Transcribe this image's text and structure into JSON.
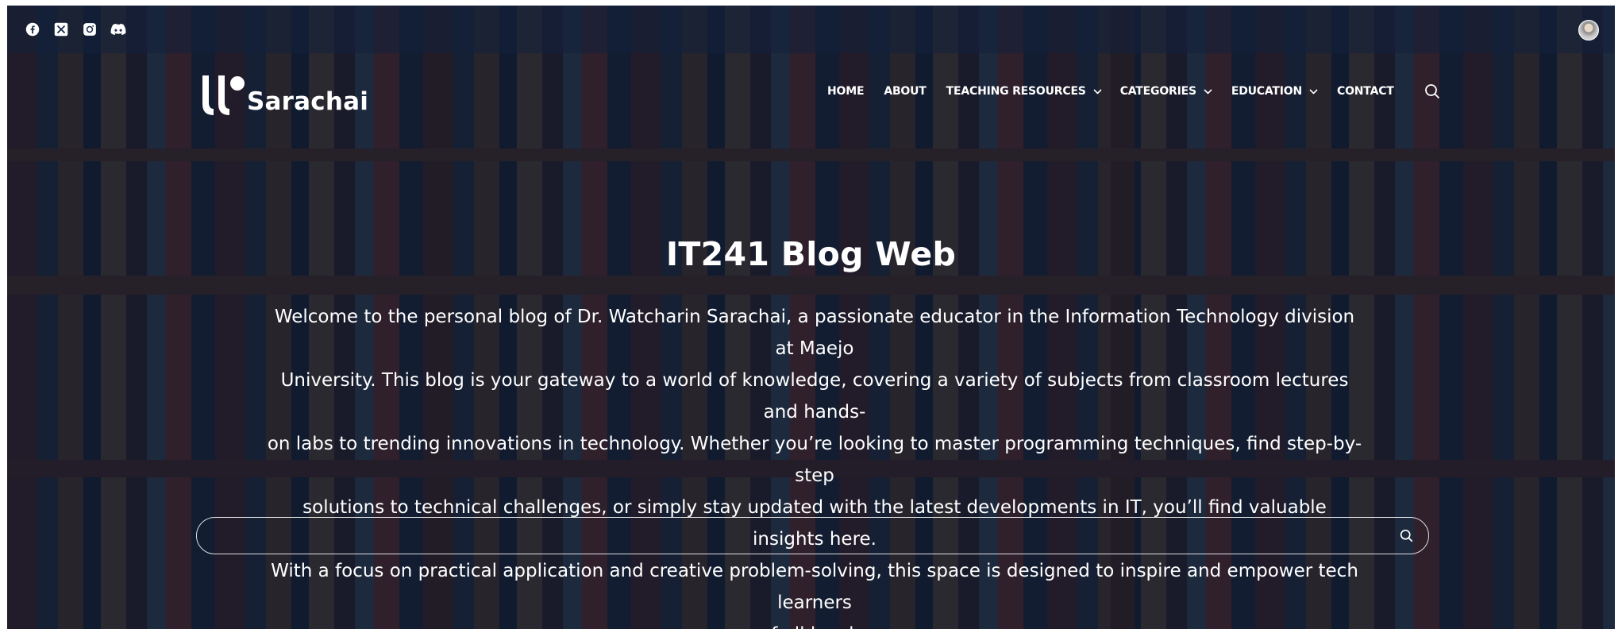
{
  "colors": {
    "overlay": "#0c162c",
    "text": "#ffffff",
    "topbar": "#12203c"
  },
  "topbar": {
    "social": [
      {
        "icon": "facebook-icon"
      },
      {
        "icon": "x-twitter-icon"
      },
      {
        "icon": "instagram-icon"
      },
      {
        "icon": "discord-icon"
      }
    ],
    "avatar_icon": "user-avatar"
  },
  "header": {
    "logo_text": "Sarachai",
    "nav": [
      {
        "label": "HOME",
        "dropdown": false
      },
      {
        "label": "ABOUT",
        "dropdown": false
      },
      {
        "label": "TEACHING RESOURCES",
        "dropdown": true
      },
      {
        "label": "CATEGORIES",
        "dropdown": true
      },
      {
        "label": "EDUCATION",
        "dropdown": true
      },
      {
        "label": "CONTACT",
        "dropdown": false
      }
    ],
    "search_icon": "search-icon"
  },
  "hero": {
    "title": "IT241 Blog Web",
    "description_lines": [
      "Welcome to the personal blog of Dr. Watcharin Sarachai, a passionate educator in the Information Technology division at Maejo",
      "University. This blog is your gateway to a world of knowledge, covering a variety of subjects from classroom lectures and hands-",
      "on labs to trending innovations in technology. Whether you’re looking to master programming techniques, find step-by-step",
      "solutions to technical challenges, or simply stay updated with the latest developments in IT, you’ll find valuable insights here.",
      "With a focus on practical application and creative problem-solving, this space is designed to inspire and empower tech learners",
      "of all levels."
    ],
    "search": {
      "value": "",
      "placeholder": "",
      "icon": "search-icon"
    }
  }
}
